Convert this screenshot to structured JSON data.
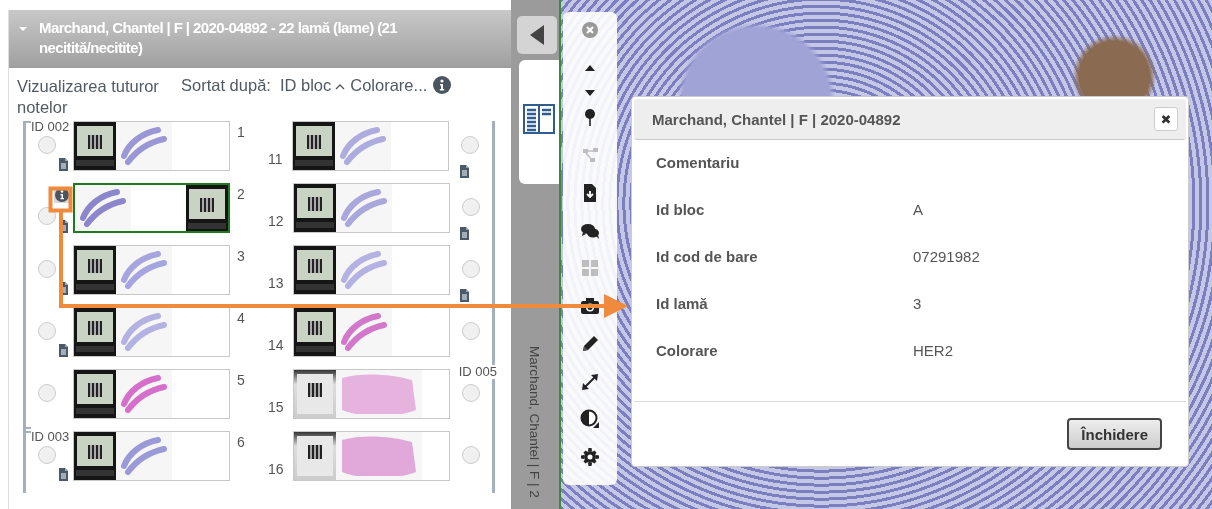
{
  "case_panel": {
    "title": "Marchand, Chantel | F | 2020-04892 - 22 lamă (lame) (21 necitită/necitite)",
    "expanded": true,
    "view_notes_link": "Vizualizarea tuturor notelor",
    "sort_label": "Sortat după:",
    "sort_options": [
      "ID bloc",
      "Colorare..."
    ],
    "rows": [
      {
        "left": {
          "number": "1",
          "group_label": "ID 002",
          "kind": "stained-label",
          "color": "#9b97d6",
          "note": true,
          "info": false,
          "selected": false,
          "checked": false,
          "flipped": false
        },
        "right": {
          "number": "11",
          "kind": "stained-label",
          "color": "#aeacdf",
          "note": true,
          "info": false,
          "selected": false,
          "checked": false,
          "flipped": false
        }
      },
      {
        "left": {
          "number": "2",
          "kind": "stained-label",
          "color": "#8c86cc",
          "note": true,
          "info": true,
          "selected": true,
          "checked": false,
          "flipped": true
        },
        "right": {
          "number": "12",
          "kind": "stained-label",
          "color": "#a9a7dc",
          "note": true,
          "info": false,
          "selected": false,
          "checked": false,
          "flipped": false
        }
      },
      {
        "left": {
          "number": "3",
          "kind": "stained-label",
          "color": "#a6a5df",
          "note": true,
          "info": false,
          "selected": false,
          "checked": false,
          "flipped": false
        },
        "right": {
          "number": "13",
          "kind": "stained-label",
          "color": "#b3b2e2",
          "note": true,
          "info": false,
          "selected": false,
          "checked": false,
          "flipped": false
        }
      },
      {
        "left": {
          "number": "4",
          "kind": "stained-label",
          "color": "#b3b2e2",
          "note": true,
          "info": false,
          "selected": false,
          "checked": false,
          "flipped": false
        },
        "right": {
          "number": "14",
          "kind": "stained-label",
          "color": "#d277c9",
          "note": false,
          "info": false,
          "selected": false,
          "checked": false,
          "flipped": false
        }
      },
      {
        "left": {
          "number": "5",
          "kind": "stained-label",
          "color": "#d66fcc",
          "note": false,
          "info": false,
          "selected": false,
          "checked": false,
          "flipped": false
        },
        "right": {
          "number": "15",
          "group_label": "ID 005",
          "kind": "printed-label",
          "color": "#e6b3de",
          "note": false,
          "info": false,
          "selected": false,
          "checked": false,
          "flipped": false
        }
      },
      {
        "left": {
          "number": "6",
          "group_label": "ID 003",
          "kind": "stained-label",
          "color": "#9b99d8",
          "note": true,
          "info": false,
          "selected": false,
          "checked": false,
          "flipped": false
        },
        "right": {
          "number": "16",
          "kind": "printed-label",
          "color": "#e0a9d9",
          "note": false,
          "info": false,
          "selected": false,
          "checked": false,
          "flipped": false
        }
      }
    ]
  },
  "side_strip": {
    "collapsed_title": "Marchand, Chantel | F | 2"
  },
  "toolbar": [
    {
      "kind": "close",
      "disabled": false
    },
    {
      "kind": "up",
      "disabled": false
    },
    {
      "kind": "down",
      "disabled": false
    },
    {
      "kind": "pin",
      "disabled": false
    },
    {
      "kind": "tree",
      "disabled": true
    },
    {
      "kind": "download",
      "disabled": false
    },
    {
      "kind": "chat",
      "disabled": false
    },
    {
      "kind": "grid",
      "disabled": true
    },
    {
      "kind": "camera",
      "disabled": false
    },
    {
      "kind": "pencil",
      "disabled": false
    },
    {
      "kind": "expand",
      "disabled": false
    },
    {
      "kind": "contrast",
      "disabled": false
    },
    {
      "kind": "gear",
      "disabled": false
    }
  ],
  "dialog": {
    "title": "Marchand, Chantel | F | 2020-04892",
    "close": "✖",
    "fields": [
      {
        "label": "Comentariu"
      },
      {
        "label": "Id bloc",
        "value": "A"
      },
      {
        "label": "Id cod de bare",
        "value": "07291982"
      },
      {
        "label": "Id lamă",
        "value": "3"
      },
      {
        "label": "Colorare",
        "value": "HER2"
      }
    ],
    "button": "Închidere"
  }
}
